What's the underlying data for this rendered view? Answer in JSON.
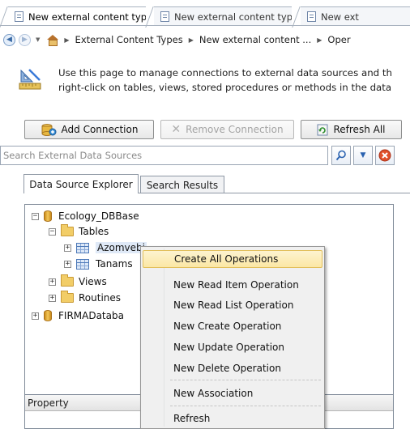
{
  "tabs": [
    {
      "label": "New external content type *"
    },
    {
      "label": "New external content type"
    },
    {
      "label": "New ext"
    }
  ],
  "breadcrumb": {
    "items": [
      "External Content Types",
      "New external content ...",
      "Oper"
    ]
  },
  "description": {
    "line1": "Use this page to manage connections to external data sources and th",
    "line2": "right-click on tables, views, stored procedures or methods in the data"
  },
  "toolbar": {
    "add_connection": "Add Connection",
    "remove_connection": "Remove Connection",
    "refresh_all": "Refresh All"
  },
  "search": {
    "placeholder": "Search External Data Sources"
  },
  "panel_tabs": {
    "explorer": "Data Source Explorer",
    "results": "Search Results"
  },
  "tree": {
    "db1": "Ecology_DBBase",
    "tables": "Tables",
    "table1": "Azomvebi",
    "table2": "Tanams",
    "views": "Views",
    "routines": "Routines",
    "db2": "FIRMADataba"
  },
  "property_grid": {
    "header": "Property"
  },
  "context_menu": {
    "items": [
      "Create All Operations",
      "New Read Item Operation",
      "New Read List Operation",
      "New Create Operation",
      "New Update Operation",
      "New Delete Operation",
      "New Association",
      "Refresh"
    ]
  },
  "colors": {
    "menu_highlight": "#fbe7a5",
    "selection": "#dfe9f7"
  }
}
